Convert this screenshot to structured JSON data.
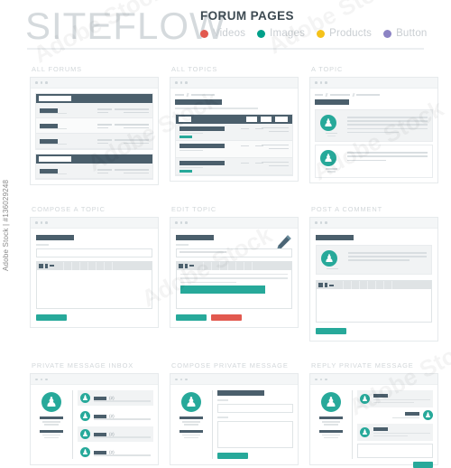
{
  "header": {
    "brand": "SITEFLOW",
    "title": "FORUM PAGES",
    "legend": [
      {
        "label": "Videos",
        "color": "#e2594f",
        "icon": "dot-icon"
      },
      {
        "label": "Images",
        "color": "#00a08a",
        "icon": "dot-icon"
      },
      {
        "label": "Products",
        "color": "#f5c21a",
        "icon": "dot-icon"
      },
      {
        "label": "Button",
        "color": "#8c83c4",
        "icon": "dot-icon"
      }
    ]
  },
  "colors": {
    "dark": "#4b5f6c",
    "teal": "#27a99a",
    "red": "#e2594f",
    "light_gray": "#f1f3f4",
    "border": "#e6eaec",
    "caption": "#d2d7da"
  },
  "mockups": [
    {
      "id": "all-forums",
      "caption": "ALL FORUMS"
    },
    {
      "id": "all-topics",
      "caption": "ALL TOPICS"
    },
    {
      "id": "a-topic",
      "caption": "A TOPIC"
    },
    {
      "id": "compose-a-topic",
      "caption": "COMPOSE A TOPIC"
    },
    {
      "id": "edit-topic",
      "caption": "EDIT TOPIC"
    },
    {
      "id": "post-a-comment",
      "caption": "POST A COMMENT"
    },
    {
      "id": "private-message-inbox",
      "caption": "PRIVATE MESSAGE INBOX"
    },
    {
      "id": "compose-private-message",
      "caption": "COMPOSE PRIVATE MESSAGE"
    },
    {
      "id": "reply-private-message",
      "caption": "REPLY PRIVATE MESSAGE"
    }
  ],
  "inbox": {
    "messages": [
      {
        "count": "(2)"
      },
      {
        "count": "(2)"
      },
      {
        "count": "(2)"
      },
      {
        "count": "(2)"
      }
    ]
  },
  "editor": {
    "toolbar_buttons": [
      "B",
      "I",
      "link"
    ]
  },
  "watermark": {
    "stamp": "Adobe Stock | #136029248",
    "tiles": [
      "Adobe Stock",
      "Adobe Stock",
      "Adobe Stock",
      "Adobe Stock",
      "Adobe Stock",
      "Adobe Stock"
    ]
  }
}
